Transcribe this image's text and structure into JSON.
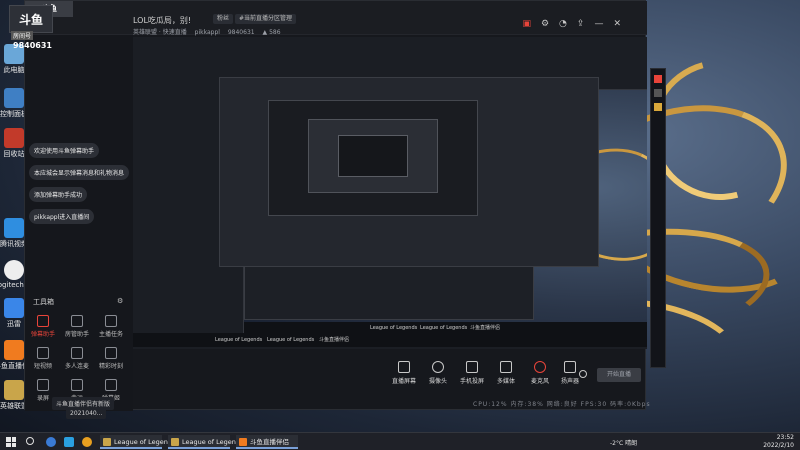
{
  "app": {
    "title": "LOL吃瓜局，别!",
    "chip_fans": "粉丝",
    "chip_tag": "#当前直播分区管理",
    "sub_category": "英雄联盟 · 快速直播",
    "sub_user": "pikkappl",
    "sub_id": "9840631",
    "sub_fire": "586",
    "logo_text": "斗鱼",
    "room_label": "房间号",
    "room_id": "9840631"
  },
  "desktop_icons": [
    "此电脑",
    "控制面板",
    "回收站",
    "腾讯视频",
    "Logitech G HUB",
    "迅雷",
    "斗鱼直播伴侣",
    "英雄联盟"
  ],
  "messages": [
    "欢迎使用斗鱼弹幕助手",
    "本应城会显示弹幕消息和礼物消息",
    "添加弹幕助手成功",
    "pikkappl进入直播间"
  ],
  "tools": {
    "title": "工具箱",
    "items": [
      {
        "label": "弹幕助手",
        "active": true
      },
      {
        "label": "房管助手",
        "active": false
      },
      {
        "label": "主播任务",
        "active": false
      },
      {
        "label": "短视频",
        "active": false
      },
      {
        "label": "多人连麦",
        "active": false
      },
      {
        "label": "精彩时刻",
        "active": false
      },
      {
        "label": "录屏",
        "active": false
      },
      {
        "label": "幸运",
        "active": false
      },
      {
        "label": "弹幕姬",
        "active": false
      }
    ]
  },
  "bottom_controls": [
    {
      "label": "直播屏幕",
      "icon": "monitor-icon"
    },
    {
      "label": "摄像头",
      "icon": "camera-icon"
    },
    {
      "label": "手机投屏",
      "icon": "phone-cast-icon"
    },
    {
      "label": "多媒体",
      "icon": "media-icon"
    },
    {
      "label": "麦克风",
      "icon": "mic-icon"
    },
    {
      "label": "扬声器",
      "icon": "speaker-icon"
    }
  ],
  "start_live_label": "开始直播",
  "status_line": "CPU:12%  内存:38%  网络:良好  FPS:30  码率:0Kbps",
  "notices": [
    "斗鱼直播伴侣有新版",
    "2021040..."
  ],
  "taskbar": {
    "apps": [
      {
        "label": "League of Legends",
        "color": "#c9a54a"
      },
      {
        "label": "League of Legen...",
        "color": "#c9a54a"
      },
      {
        "label": "斗鱼直播伴侣",
        "color": "#f07b1f"
      }
    ],
    "temp": "-2°C  晴朗",
    "time": "23:52",
    "date": "2022/2/10"
  },
  "inner_taskbar": [
    "League of Legends",
    "League of Legends",
    "斗鱼直播伴侣"
  ]
}
